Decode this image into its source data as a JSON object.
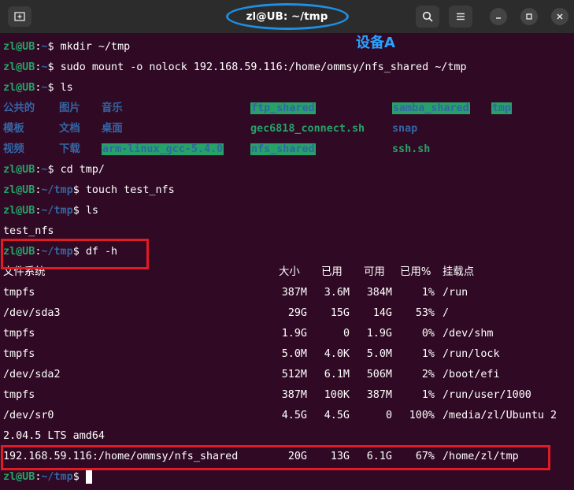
{
  "window": {
    "title": "zl@UB: ~/tmp",
    "annotation_label": "设备A"
  },
  "prompt": {
    "user_host": "zl@UB",
    "home_path": "~",
    "tmp_path": "~/tmp",
    "sep": ":",
    "dollar": "$"
  },
  "lines": {
    "mkdir": "mkdir ~/tmp",
    "mount": "sudo mount -o nolock 192.168.59.116:/home/ommsy/nfs_shared ~/tmp",
    "ls1": "ls",
    "cd": "cd tmp/",
    "touch": "touch test_nfs",
    "ls2": "ls",
    "ls2_output": "test_nfs",
    "df": "df -h"
  },
  "home_listing": {
    "row1": [
      "公共的",
      "图片",
      "音乐",
      "ftp_shared",
      "samba_shared",
      "tmp"
    ],
    "row2": [
      "模板",
      "文档",
      "桌面",
      "gec6818_connect.sh",
      "snap"
    ],
    "row3": [
      "视频",
      "下载",
      "arm-linux_gcc-5.4.0",
      "nfs_shared",
      "ssh.sh"
    ]
  },
  "df_table": {
    "headers": [
      "文件系统",
      "大小",
      "已用",
      "可用",
      "已用%",
      "挂载点"
    ],
    "rows": [
      [
        "tmpfs",
        "387M",
        "3.6M",
        "384M",
        "1%",
        "/run"
      ],
      [
        "/dev/sda3",
        "29G",
        "15G",
        "14G",
        "53%",
        "/"
      ],
      [
        "tmpfs",
        "1.9G",
        "0",
        "1.9G",
        "0%",
        "/dev/shm"
      ],
      [
        "tmpfs",
        "5.0M",
        "4.0K",
        "5.0M",
        "1%",
        "/run/lock"
      ],
      [
        "/dev/sda2",
        "512M",
        "6.1M",
        "506M",
        "2%",
        "/boot/efi"
      ],
      [
        "tmpfs",
        "387M",
        "100K",
        "387M",
        "1%",
        "/run/user/1000"
      ],
      [
        "/dev/sr0",
        "4.5G",
        "4.5G",
        "0",
        "100%",
        "/media/zl/Ubuntu 2"
      ]
    ],
    "wrap_line": "2.04.5 LTS amd64",
    "nfs_row": [
      "192.168.59.116:/home/ommsy/nfs_shared",
      "20G",
      "13G",
      "6.1G",
      "67%",
      "/home/zl/tmp"
    ]
  },
  "icons": {
    "new_tab": "new-tab-icon",
    "search": "search-icon",
    "menu": "hamburger-icon",
    "minimize": "minimize-icon",
    "maximize": "maximize-icon",
    "close": "close-icon"
  },
  "colors": {
    "terminal_bg": "#300a24",
    "prompt_user": "#26a269",
    "prompt_path": "#3465a4",
    "highlight_bg": "#26a269",
    "annotation_blue": "#1e8fe0",
    "annotation_red": "#e01b24"
  }
}
